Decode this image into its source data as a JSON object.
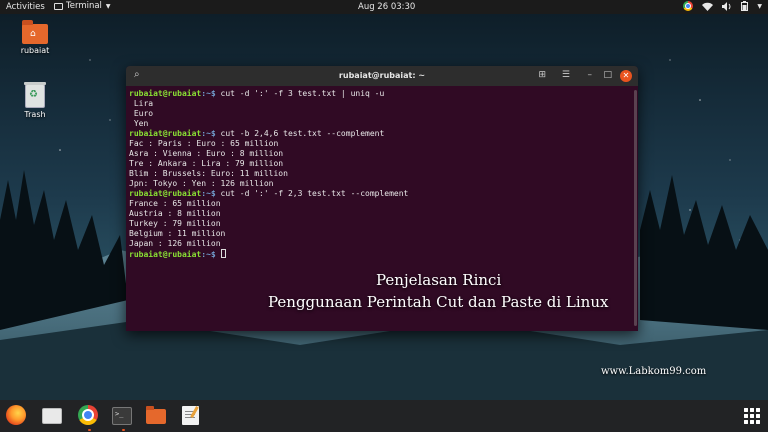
{
  "topbar": {
    "activities": "Activities",
    "app_menu": "Terminal",
    "clock": "Aug 26  03:30",
    "tray_icons": [
      "chrome-icon",
      "wifi-icon",
      "volume-icon",
      "battery-icon",
      "chevron-down-icon"
    ]
  },
  "desktop": {
    "icons": [
      {
        "label": "rubaiat",
        "icon": "home-folder-icon"
      },
      {
        "label": "Trash",
        "icon": "trash-icon"
      }
    ]
  },
  "terminal": {
    "title": "rubaiat@rubaiat: ~",
    "prompt_user": "rubaiat@rubaiat",
    "prompt_path": ":~$",
    "lines": [
      {
        "type": "cmd",
        "text": " cut -d ':' -f 3 test.txt | uniq -u"
      },
      {
        "type": "out",
        "text": " Lira"
      },
      {
        "type": "out",
        "text": " Euro"
      },
      {
        "type": "out",
        "text": " Yen"
      },
      {
        "type": "cmd",
        "text": " cut -b 2,4,6 test.txt --complement"
      },
      {
        "type": "out",
        "text": "Fac : Paris : Euro : 65 million"
      },
      {
        "type": "out",
        "text": "Asra : Vienna : Euro : 8 million"
      },
      {
        "type": "out",
        "text": "Tre : Ankara : Lira : 79 million"
      },
      {
        "type": "out",
        "text": "Blim : Brussels: Euro: 11 million"
      },
      {
        "type": "out",
        "text": "Jpn: Tokyo : Yen : 126 million"
      },
      {
        "type": "cmd",
        "text": " cut -d ':' -f 2,3 test.txt --complement"
      },
      {
        "type": "out",
        "text": "France : 65 million"
      },
      {
        "type": "out",
        "text": "Austria : 8 million"
      },
      {
        "type": "out",
        "text": "Turkey : 79 million"
      },
      {
        "type": "out",
        "text": "Belgium : 11 million"
      },
      {
        "type": "out",
        "text": "Japan : 126 million"
      },
      {
        "type": "prompt",
        "text": " "
      }
    ]
  },
  "overlay": {
    "line1": "Penjelasan Rinci",
    "line2": "Penggunaan Perintah Cut dan Paste di Linux",
    "watermark": "www.Labkom99.com"
  },
  "dock": {
    "items": [
      "firefox-icon",
      "files-icon",
      "chrome-icon",
      "terminal-icon",
      "folder-icon",
      "text-editor-icon"
    ],
    "terminal_icon_text": ">_"
  },
  "colors": {
    "terminal_bg": "#300a24",
    "prompt_green": "#8ae234",
    "path_blue": "#729fcf",
    "accent_orange": "#e95420"
  }
}
